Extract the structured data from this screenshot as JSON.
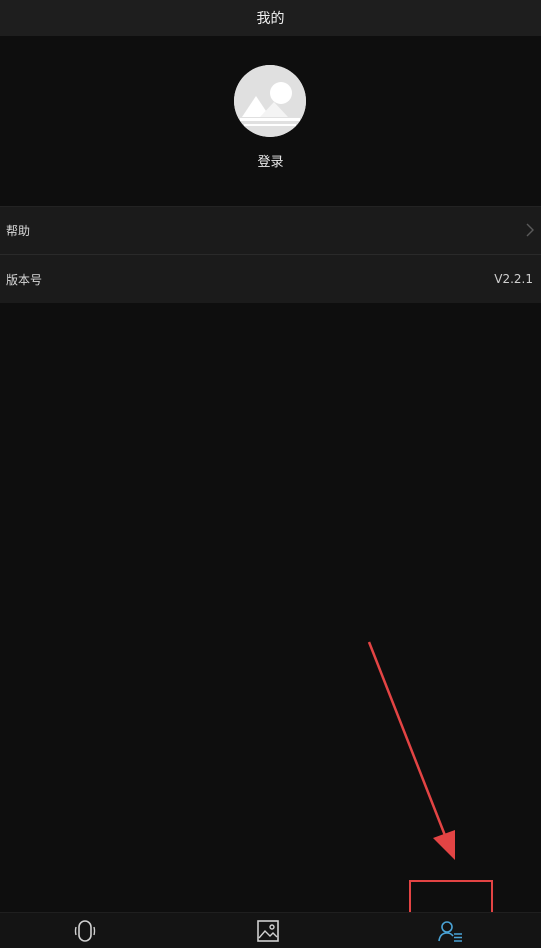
{
  "header": {
    "title": "我的"
  },
  "profile": {
    "login_label": "登录"
  },
  "menu": {
    "help_label": "帮助",
    "version_label": "版本号",
    "version_value": "V2.2.1"
  },
  "tabbar": {
    "items": [
      {
        "icon": "device-icon"
      },
      {
        "icon": "image-icon"
      },
      {
        "icon": "profile-list-icon",
        "active": true
      }
    ]
  },
  "colors": {
    "background": "#0e0e0e",
    "title_bar": "#1e1e1e",
    "row": "#1b1b1b",
    "active_tab": "#4aa3d6",
    "annotation": "#e34444"
  }
}
